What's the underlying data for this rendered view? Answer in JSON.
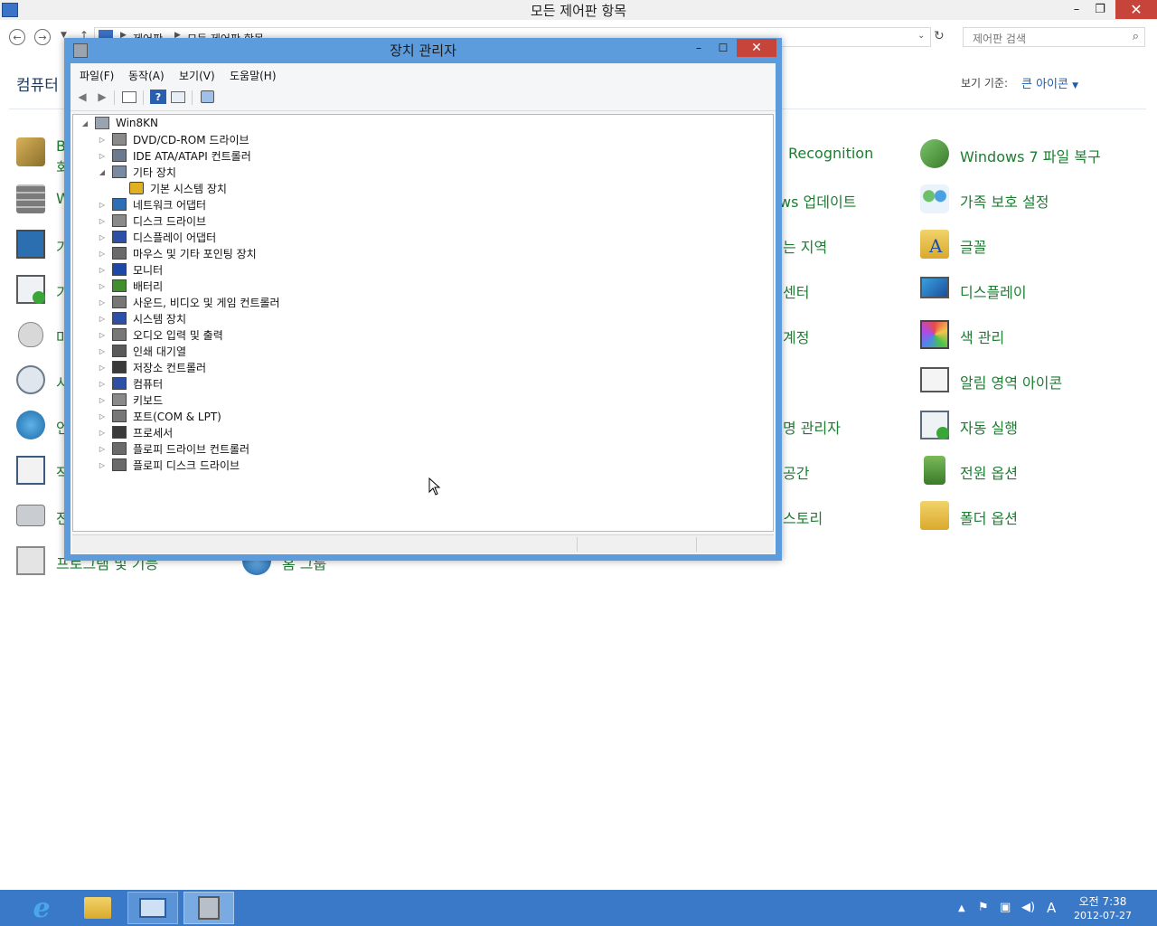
{
  "control_panel": {
    "window_title": "모든 제어판 항목",
    "breadcrumb": [
      "제어판",
      "모든 제어판 항목"
    ],
    "search_placeholder": "제어판 검색",
    "heading": "컴퓨터",
    "view_by_label": "보기 기준:",
    "view_by_value": "큰 아이콘",
    "left_items": [
      {
        "label": "B",
        "sub": "회",
        "icon": "bitlocker-key-icon"
      },
      {
        "label": "W",
        "icon": "firewall-icon"
      },
      {
        "label": "기",
        "icon": "default-programs-icon"
      },
      {
        "label": "기",
        "icon": "action-center-icon"
      },
      {
        "label": "마",
        "icon": "mouse-icon"
      },
      {
        "label": "시",
        "icon": "indexing-icon"
      },
      {
        "label": "언",
        "icon": "language-icon"
      },
      {
        "label": "작",
        "icon": "task-icon"
      },
      {
        "label": "전",
        "icon": "phone-modem-icon"
      },
      {
        "label": "프로그램 및 기능",
        "icon": "programs-features-icon"
      }
    ],
    "mid_items": [
      {
        "label": "Recognition"
      },
      {
        "label": "ws 업데이트"
      },
      {
        "label": "는 지역"
      },
      {
        "label": "센터"
      },
      {
        "label": "계정"
      },
      {
        "label": ""
      },
      {
        "label": "명 관리자"
      },
      {
        "label": "공간"
      },
      {
        "label": "스토리"
      },
      {
        "label": "홈 그룹"
      }
    ],
    "right_items": [
      {
        "label": "Windows 7 파일 복구",
        "icon": "file-recovery-icon"
      },
      {
        "label": "가족 보호 설정",
        "icon": "family-safety-icon"
      },
      {
        "label": "글꼴",
        "icon": "fonts-folder-icon"
      },
      {
        "label": "디스플레이",
        "icon": "display-icon"
      },
      {
        "label": "색 관리",
        "icon": "color-management-icon"
      },
      {
        "label": "알림 영역 아이콘",
        "icon": "notification-area-icon"
      },
      {
        "label": "자동 실행",
        "icon": "autoplay-icon"
      },
      {
        "label": "전원 옵션",
        "icon": "power-options-icon"
      },
      {
        "label": "폴더 옵션",
        "icon": "folder-options-icon"
      }
    ]
  },
  "device_manager": {
    "title": "장치 관리자",
    "menu": [
      "파일(F)",
      "동작(A)",
      "보기(V)",
      "도움말(H)"
    ],
    "root": "Win8KN",
    "nodes": [
      {
        "label": "DVD/CD-ROM 드라이브",
        "expander": "▷",
        "icon": "dvd-drive-icon",
        "color": "#8a8a8a"
      },
      {
        "label": "IDE ATA/ATAPI 컨트롤러",
        "expander": "▷",
        "icon": "ide-controller-icon",
        "color": "#6b7a8c"
      },
      {
        "label": "기타 장치",
        "expander": "◢",
        "icon": "unknown-device-icon",
        "color": "#7a8aa0"
      },
      {
        "label": "기본 시스템 장치",
        "expander": "",
        "icon": "warning-device-icon",
        "color": "#e0b020",
        "child": true
      },
      {
        "label": "네트워크 어댑터",
        "expander": "▷",
        "icon": "network-adapter-icon",
        "color": "#2d6fb5"
      },
      {
        "label": "디스크 드라이브",
        "expander": "▷",
        "icon": "disk-drive-icon",
        "color": "#8a8a8a"
      },
      {
        "label": "디스플레이 어댑터",
        "expander": "▷",
        "icon": "display-adapter-icon",
        "color": "#2d4fa5"
      },
      {
        "label": "마우스 및 기타 포인팅 장치",
        "expander": "▷",
        "icon": "mouse-device-icon",
        "color": "#6a6a6a"
      },
      {
        "label": "모니터",
        "expander": "▷",
        "icon": "monitor-icon",
        "color": "#1e48a8"
      },
      {
        "label": "배터리",
        "expander": "▷",
        "icon": "battery-icon",
        "color": "#3f8f2f"
      },
      {
        "label": "사운드, 비디오 및 게임 컨트롤러",
        "expander": "▷",
        "icon": "sound-icon",
        "color": "#777777"
      },
      {
        "label": "시스템 장치",
        "expander": "▷",
        "icon": "system-device-icon",
        "color": "#2d4fa5"
      },
      {
        "label": "오디오 입력 및 출력",
        "expander": "▷",
        "icon": "audio-io-icon",
        "color": "#777777"
      },
      {
        "label": "인쇄 대기열",
        "expander": "▷",
        "icon": "printer-icon",
        "color": "#5a5a5a"
      },
      {
        "label": "저장소 컨트롤러",
        "expander": "▷",
        "icon": "storage-controller-icon",
        "color": "#3a3a3a"
      },
      {
        "label": "컴퓨터",
        "expander": "▷",
        "icon": "computer-icon",
        "color": "#2d4fa5"
      },
      {
        "label": "키보드",
        "expander": "▷",
        "icon": "keyboard-icon",
        "color": "#8a8a8a"
      },
      {
        "label": "포트(COM & LPT)",
        "expander": "▷",
        "icon": "port-icon",
        "color": "#777777"
      },
      {
        "label": "프로세서",
        "expander": "▷",
        "icon": "processor-icon",
        "color": "#3a3a3a"
      },
      {
        "label": "플로피 드라이브 컨트롤러",
        "expander": "▷",
        "icon": "floppy-controller-icon",
        "color": "#6a6a6a"
      },
      {
        "label": "플로피 디스크 드라이브",
        "expander": "▷",
        "icon": "floppy-drive-icon",
        "color": "#6a6a6a"
      }
    ]
  },
  "taskbar": {
    "time": "오전 7:38",
    "date": "2012-07-27",
    "ime": "A",
    "apps": [
      "internet-explorer-icon",
      "file-explorer-icon",
      "control-panel-icon",
      "device-manager-icon"
    ]
  }
}
